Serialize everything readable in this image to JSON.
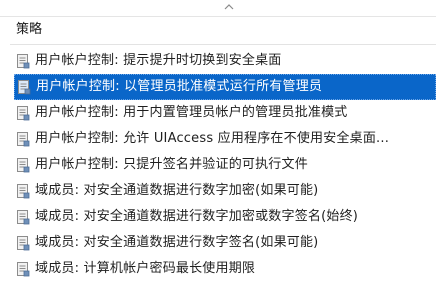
{
  "header": {
    "column_label": "策略"
  },
  "policies": [
    {
      "label": "用户帐户控制: 提示提升时切换到安全桌面",
      "selected": false
    },
    {
      "label": "用户帐户控制: 以管理员批准模式运行所有管理员",
      "selected": true
    },
    {
      "label": "用户帐户控制: 用于内置管理员帐户的管理员批准模式",
      "selected": false
    },
    {
      "label": "用户帐户控制: 允许 UIAccess 应用程序在不使用安全桌面...",
      "selected": false
    },
    {
      "label": "用户帐户控制: 只提升签名并验证的可执行文件",
      "selected": false
    },
    {
      "label": "域成员: 对安全通道数据进行数字加密(如果可能)",
      "selected": false
    },
    {
      "label": "域成员: 对安全通道数据进行数字加密或数字签名(始终)",
      "selected": false
    },
    {
      "label": "域成员: 对安全通道数据进行数字签名(如果可能)",
      "selected": false
    },
    {
      "label": "域成员: 计算机帐户密码最长使用期限",
      "selected": false
    }
  ],
  "colors": {
    "selection": "#0a66c9",
    "text": "#1f1f1f"
  },
  "icons": {
    "row_icon": "policy-document-icon",
    "sort_icon": "sort-ascending-icon"
  }
}
